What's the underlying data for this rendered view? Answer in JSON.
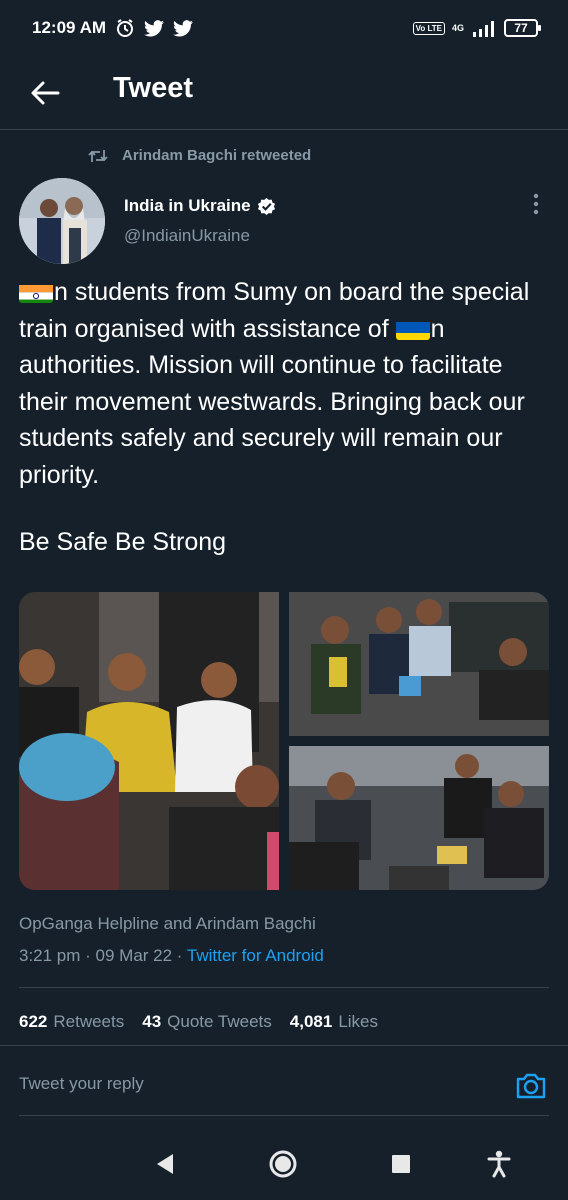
{
  "status_bar": {
    "time": "12:09 AM",
    "network": "4G",
    "volte": "Vo LTE",
    "battery": "77"
  },
  "header": {
    "title": "Tweet"
  },
  "tweet": {
    "retweet_label": "Arindam Bagchi retweeted",
    "author_name": "India in Ukraine",
    "author_handle": "@IndiainUkraine",
    "body_line1": "n students from Sumy on board the special train organised with assistance of ",
    "body_line2": "n authorities. Mission will continue to facilitate their movement westwards. Bringing back our students safely and securely will remain our priority.",
    "tagline": "Be Safe Be Strong",
    "source": "OpGanga Helpline and Arindam Bagchi",
    "timestamp": "3:21 pm · 09 Mar 22 · ",
    "client": "Twitter for Android",
    "stats": {
      "retweets_count": "622",
      "retweets_label": "Retweets",
      "quotes_count": "43",
      "quotes_label": "Quote Tweets",
      "likes_count": "4,081",
      "likes_label": "Likes"
    }
  },
  "reply": {
    "placeholder": "Tweet your reply"
  },
  "colors": {
    "background": "#15202b",
    "muted": "#8899a6",
    "accent": "#1da1f2",
    "divider": "#38444d"
  },
  "icons": {
    "back": "arrow-left-icon",
    "retweet": "retweet-icon",
    "verified": "verified-badge-icon",
    "more": "more-vertical-icon",
    "camera": "camera-icon",
    "nav_back": "triangle-back-icon",
    "nav_home": "circle-home-icon",
    "nav_recents": "square-recents-icon",
    "accessibility": "accessibility-icon"
  }
}
